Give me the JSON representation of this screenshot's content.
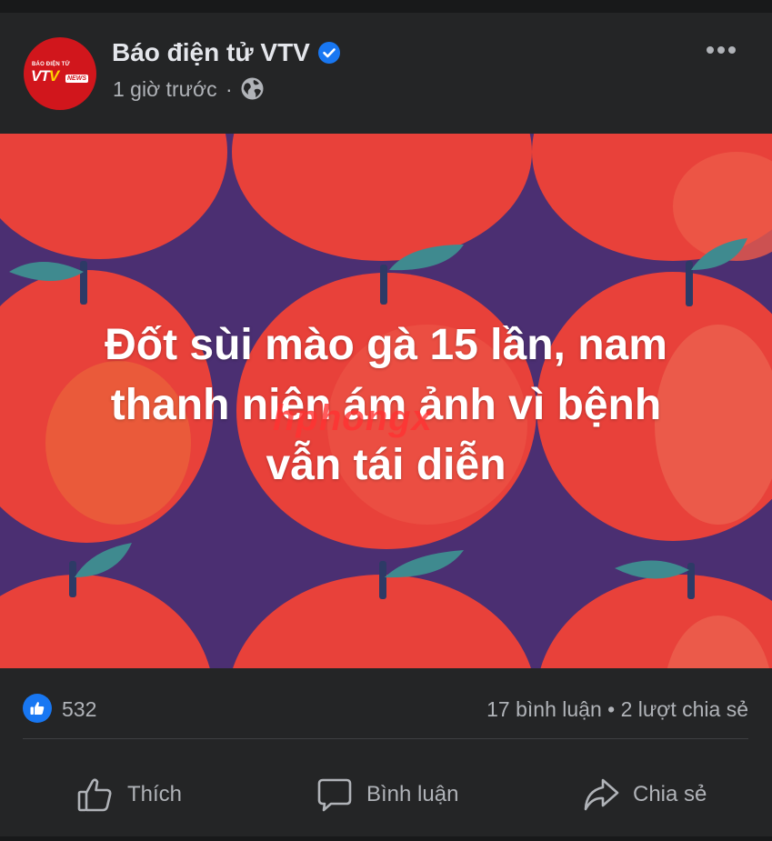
{
  "post": {
    "page_name": "Báo điện tử VTV",
    "time": "1 giờ trước",
    "separator": "·",
    "privacy_icon": "globe-icon",
    "verified_icon": "verified-badge-icon",
    "more_icon": "more-options-icon",
    "avatar": {
      "small_text": "BÁO ĐIỆN TỬ",
      "logo_text_white": "VT",
      "logo_text_accent": "V",
      "news_text": "NEWS"
    }
  },
  "image": {
    "headline_lines": [
      "Đốt sùi mào gà 15 lần, nam",
      "thanh niên ám ảnh vì bệnh",
      "vẫn tái diễn"
    ],
    "watermark": "hphongx",
    "background_color": "#4b2f72",
    "fruit_color": "#e8413a",
    "leaf_color": "#3f8a8f"
  },
  "stats": {
    "like_icon": "like-reaction-icon",
    "like_count": "532",
    "comments_shares": "17 bình luận • 2 lượt chia sẻ"
  },
  "actions": {
    "like_label": "Thích",
    "comment_label": "Bình luận",
    "share_label": "Chia sẻ"
  },
  "colors": {
    "card_bg": "#242526",
    "app_bg": "#18191a",
    "text_primary": "#e4e6eb",
    "text_secondary": "#b0b3b8",
    "accent_blue": "#1877f2"
  }
}
